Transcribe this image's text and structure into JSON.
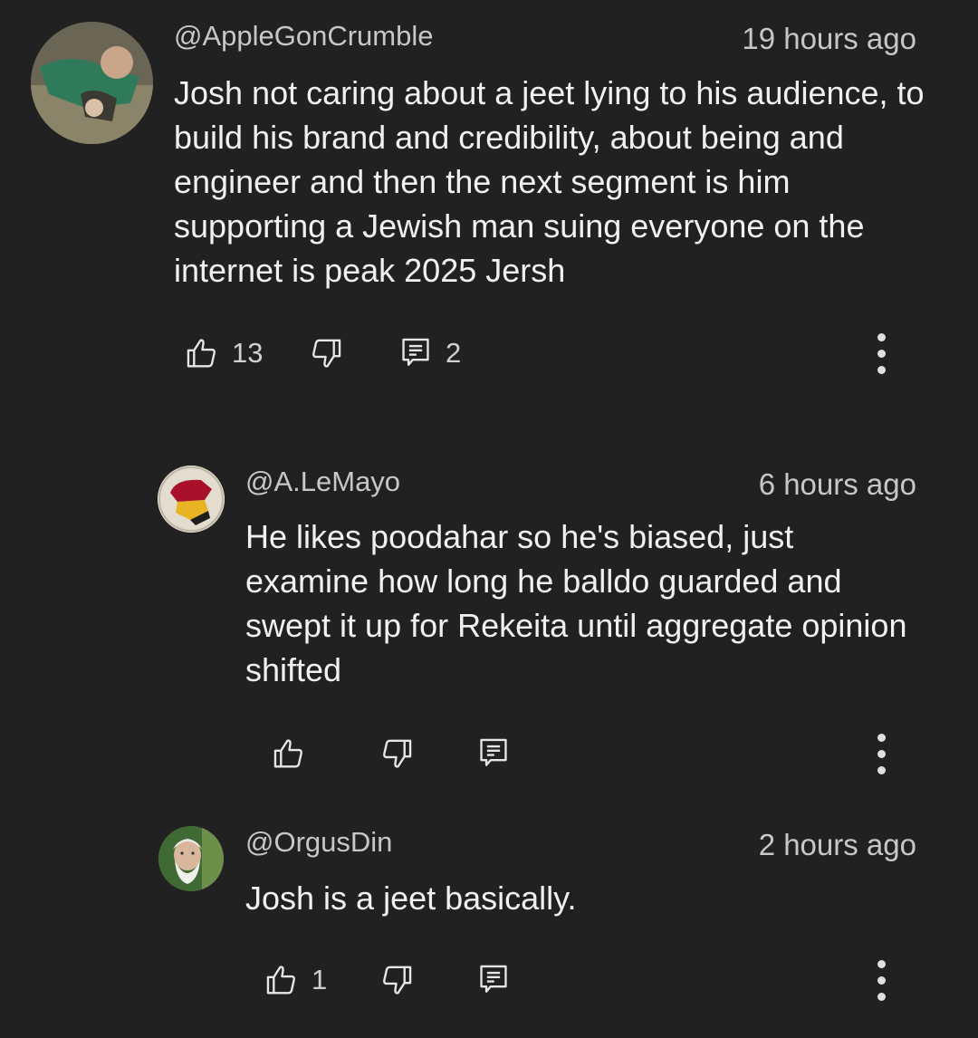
{
  "comments": [
    {
      "handle": "@AppleGonCrumble",
      "time": "19 hours ago",
      "text": "Josh not caring about a jeet lying to his audience, to build his brand and credibility, about being and engineer and then the next segment is him supporting a Jewish man suing everyone on the internet is peak 2025 Jersh",
      "likes": "13",
      "replies": "2",
      "avatar_icon": "avatar-photo"
    },
    {
      "handle": "@A.LeMayo",
      "time": "6 hours ago",
      "text": "He likes poodahar so he's biased, just examine how long he balldo guarded and swept it up for Rekeita until aggregate opinion shifted",
      "likes": "",
      "replies": "",
      "avatar_icon": "avatar-red-pattern"
    },
    {
      "handle": "@OrgusDin",
      "time": "2 hours ago",
      "text": "Josh is a jeet basically.",
      "likes": "1",
      "replies": "",
      "avatar_icon": "avatar-bearded-man"
    }
  ],
  "icons": {
    "like": "thumbs-up-icon",
    "dislike": "thumbs-down-icon",
    "reply": "reply-icon",
    "more": "more-vert-icon"
  },
  "colors": {
    "background": "#212121",
    "text": "#f1f1f1",
    "secondary": "#c7c7c7"
  }
}
